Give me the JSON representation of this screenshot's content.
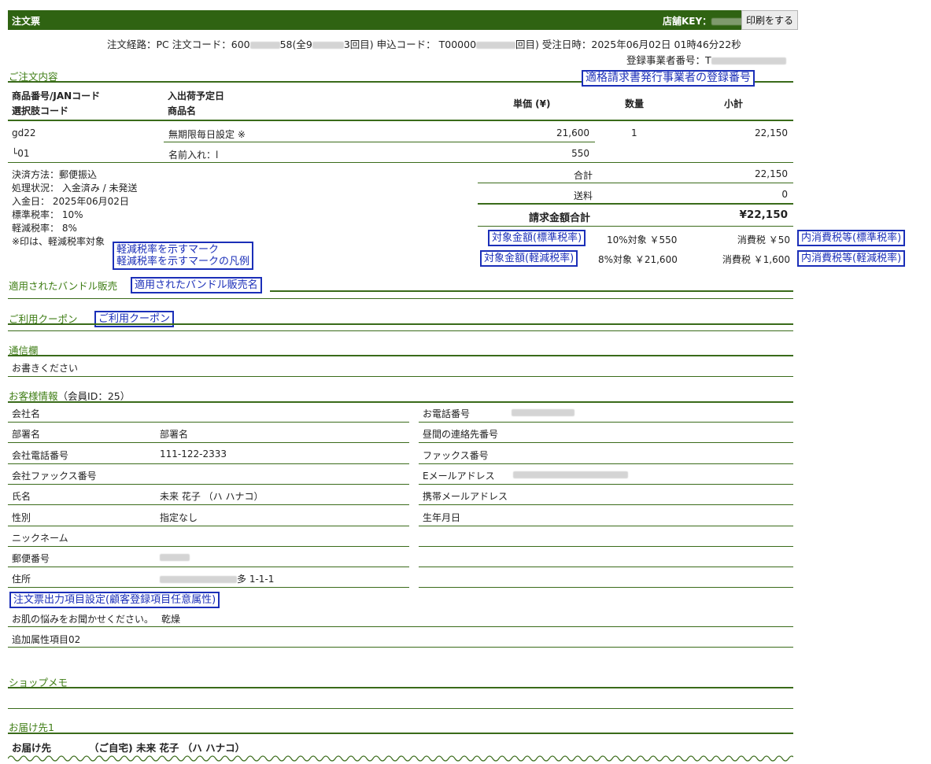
{
  "header": {
    "title": "注文票",
    "store_key_label": "店舗KEY：",
    "print_button": "印刷をする"
  },
  "order_info": {
    "line1_prefix": "注文経路：PC 注文コード：600",
    "line1_mid1": "58(全9",
    "line1_mid2": "3回目) 申込コード： T00000",
    "line1_mid3": "回目) 受注日時：2025年06月02日 01時46分22秒",
    "line2": "登録事業者番号：T"
  },
  "annotations": {
    "invoice_reg": "適格請求書発行事業者の登録番号",
    "reduced_mark_1": "軽減税率を示すマーク",
    "reduced_mark_2": "軽減税率を示すマークの凡例",
    "target_standard": "対象金額(標準税率)",
    "target_reduced": "対象金額(軽減税率)",
    "inner_tax_standard": "内消費税等(標準税率)",
    "inner_tax_reduced": "内消費税等(軽減税率)",
    "bundle_name": "適用されたバンドル販売名",
    "coupon": "ご利用クーポン",
    "output_setting": "注文票出力項目設定(顧客登録項目任意属性)"
  },
  "order_section": {
    "title": "ご注文内容",
    "col_code_1": "商品番号/JANコード",
    "col_code_2": "選択肢コード",
    "col_name_1": "入出荷予定日",
    "col_name_2": "商品名",
    "col_price": "単価 (¥)",
    "col_qty": "数量",
    "col_subtotal": "小計",
    "items": [
      {
        "code": "gd22",
        "name": "無期限毎日設定 ※",
        "price": "21,600",
        "qty": "1",
        "subtotal": "22,150"
      },
      {
        "code": "└01",
        "name": "名前入れ：l",
        "price": "550",
        "qty": "",
        "subtotal": ""
      }
    ],
    "payment_lines": [
      "決済方法：郵便振込",
      "処理状況： 入金済み / 未発送",
      "入金日： 2025年06月02日",
      "標準税率： 10%",
      "軽減税率： 8%",
      "※印は、軽減税率対象"
    ],
    "total_label": "合計",
    "total_value": "22,150",
    "shipping_label": "送料",
    "shipping_value": "0",
    "billing_label": "請求金額合計",
    "billing_value": "¥22,150",
    "std_target": "10%対象 ￥550",
    "std_tax": "消費税 ￥50",
    "red_target": "8%対象 ￥21,600",
    "red_tax": "消費税 ￥1,600"
  },
  "sections": {
    "bundle": "適用されたバンドル販売",
    "coupon": "ご利用クーポン",
    "message": "通信欄",
    "message_value": "お書きください",
    "customer": "お客様情報",
    "customer_id": "（会員ID：25）",
    "shop_memo": "ショップメモ",
    "delivery": "お届け先1"
  },
  "customer_left": [
    {
      "label": "会社名",
      "value": ""
    },
    {
      "label": "部署名",
      "value": "部署名"
    },
    {
      "label": "会社電話番号",
      "value": "111-122-2333"
    },
    {
      "label": "会社ファックス番号",
      "value": ""
    },
    {
      "label": "氏名",
      "value": "未来 花子 （ハ ハナコ）"
    },
    {
      "label": "性別",
      "value": "指定なし"
    },
    {
      "label": "ニックネーム",
      "value": ""
    },
    {
      "label": "郵便番号",
      "value": ""
    },
    {
      "label": "住所",
      "value": "多 1-1-1"
    }
  ],
  "customer_right": [
    {
      "label": "お電話番号"
    },
    {
      "label": "昼間の連絡先番号"
    },
    {
      "label": "ファックス番号"
    },
    {
      "label": "Eメールアドレス"
    },
    {
      "label": "携帯メールアドレス"
    },
    {
      "label": "生年月日"
    }
  ],
  "custom_attrs": [
    {
      "label": "お肌の悩みをお聞かせください。",
      "value": "乾燥"
    },
    {
      "label": "追加属性項目02",
      "value": ""
    }
  ],
  "delivery": {
    "label": "お届け先",
    "value": "（ご自宅) 未来 花子 （ハ ハナコ）"
  }
}
